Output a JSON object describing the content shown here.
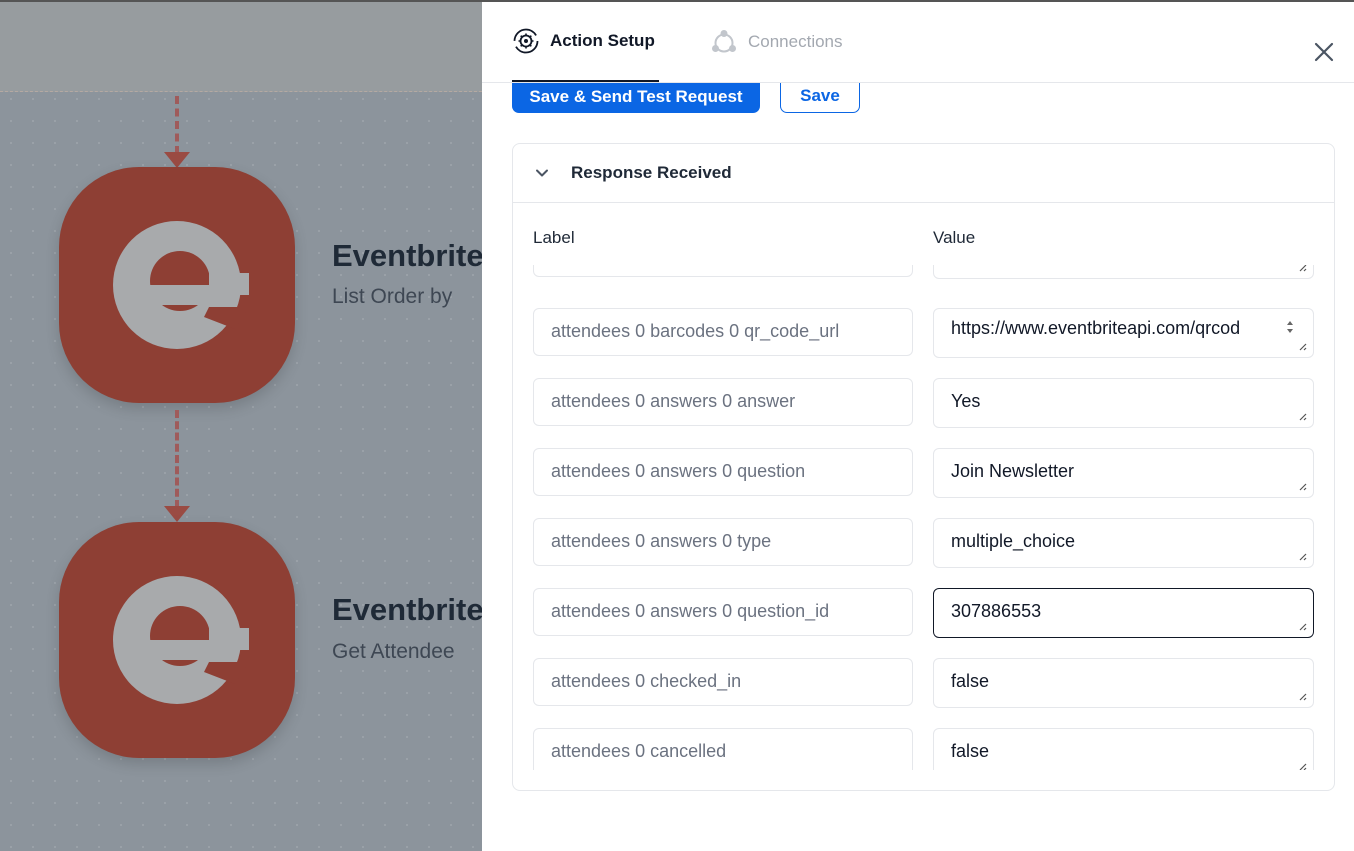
{
  "canvas": {
    "nodes": [
      {
        "title": "Eventbrite",
        "subtitle": "List Order by",
        "icon": "eventbrite-logo"
      },
      {
        "title": "Eventbrite",
        "subtitle": "Get Attendee",
        "icon": "eventbrite-logo"
      }
    ]
  },
  "panel": {
    "tabs": [
      {
        "label": "Action Setup",
        "icon": "gear-cycle-icon",
        "active": true
      },
      {
        "label": "Connections",
        "icon": "connections-icon",
        "active": false
      }
    ],
    "close_icon": "close-icon",
    "buttons": {
      "primary": "Save & Send Test Request",
      "secondary": "Save"
    },
    "response": {
      "title": "Response Received",
      "columns": {
        "label": "Label",
        "value": "Value"
      },
      "rows": [
        {
          "label": "",
          "value": ""
        },
        {
          "label": "attendees 0 barcodes 0 qr_code_url",
          "value": "https://www.eventbriteapi.com/qrcod"
        },
        {
          "label": "attendees 0 answers 0 answer",
          "value": "Yes"
        },
        {
          "label": "attendees 0 answers 0 question",
          "value": "Join Newsletter"
        },
        {
          "label": "attendees 0 answers 0 type",
          "value": "multiple_choice"
        },
        {
          "label": "attendees 0 answers 0 question_id",
          "value": "307886553"
        },
        {
          "label": "attendees 0 checked_in",
          "value": "false"
        },
        {
          "label": "attendees 0 cancelled",
          "value": "false"
        }
      ]
    }
  },
  "colors": {
    "primary": "#0b66e4",
    "node": "#8e3f34",
    "overlay": "#8c949c"
  }
}
